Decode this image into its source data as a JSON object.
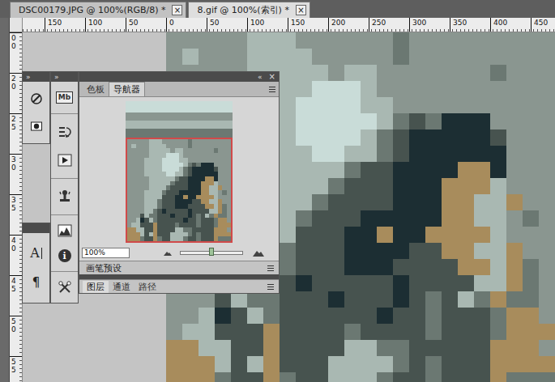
{
  "document_tabs": [
    {
      "label": "DSC00179.JPG @ 100%(RGB/8) *",
      "close": "×",
      "selected": false
    },
    {
      "label": "8.gif @ 100%(索引) *",
      "close": "×",
      "selected": true
    }
  ],
  "ruler_horizontal": [
    "150",
    "100",
    "50",
    "0",
    "50",
    "100",
    "150",
    "200",
    "250",
    "300",
    "350",
    "400",
    "450"
  ],
  "ruler_vertical": [
    "00",
    "20",
    "25",
    "30",
    "35",
    "40",
    "45",
    "50",
    "55"
  ],
  "tool_panel": {
    "expand": "»",
    "mini_bridge_button": "Mb",
    "character_button": "A",
    "paragraph_button": "¶",
    "info_button": "i"
  },
  "navigator": {
    "expand": "»",
    "collapse": "«",
    "close": "×",
    "tabs": [
      {
        "label": "色板",
        "selected": false
      },
      {
        "label": "导航器",
        "selected": true
      }
    ],
    "zoom": "100%",
    "zoom_level": 0.5
  },
  "brush_presets": {
    "title": "画笔预设"
  },
  "layers_panel": {
    "tabs": [
      {
        "label": "图层",
        "selected": true
      },
      {
        "label": "通道",
        "selected": false
      },
      {
        "label": "路径",
        "selected": false
      }
    ]
  }
}
